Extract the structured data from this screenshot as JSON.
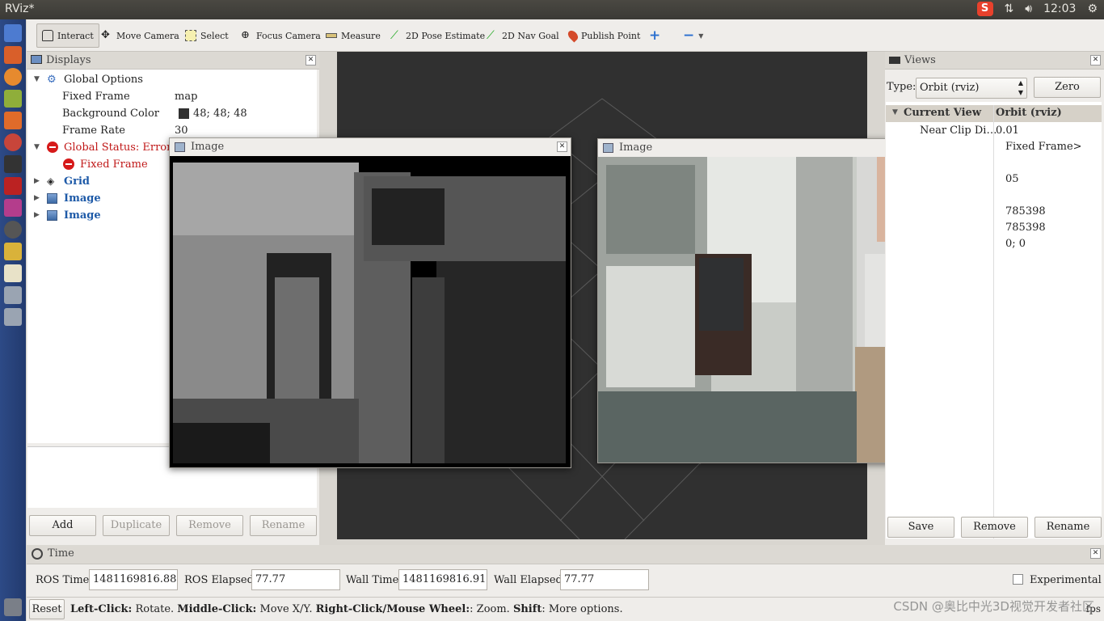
{
  "app": {
    "title": "RViz*"
  },
  "tray": {
    "clock": "12:03"
  },
  "toolbar": {
    "tools": [
      "Interact",
      "Move Camera",
      "Select",
      "Focus Camera",
      "Measure",
      "2D Pose Estimate",
      "2D Nav Goal",
      "Publish Point"
    ]
  },
  "displays": {
    "title": "Displays",
    "global_options": "Global Options",
    "fixed_frame_label": "Fixed Frame",
    "fixed_frame_value": "map",
    "bg_color_label": "Background Color",
    "bg_color_value": "48; 48; 48",
    "frame_rate_label": "Frame Rate",
    "frame_rate_value": "30",
    "global_status": "Global Status: Error",
    "fixed_frame_error": "Fixed Frame",
    "items": [
      "Grid",
      "Image",
      "Image"
    ],
    "buttons": {
      "add": "Add",
      "duplicate": "Duplicate",
      "remove": "Remove",
      "rename": "Rename"
    }
  },
  "image_windows": {
    "left_title": "Image",
    "right_title": "Image"
  },
  "views": {
    "title": "Views",
    "type_label": "Type:",
    "type_value": "Orbit (rviz)",
    "zero": "Zero",
    "current_view": "Current View",
    "current_view_value": "Orbit (rviz)",
    "near_clip": "Near Clip Di…",
    "near_clip_value": "0.01",
    "target_frame_value": "Fixed Frame>",
    "partial_values": [
      "05",
      "785398",
      "785398",
      "0; 0"
    ],
    "buttons": {
      "save": "Save",
      "remove": "Remove",
      "rename": "Rename"
    }
  },
  "time": {
    "title": "Time",
    "ros_time_label": "ROS Time:",
    "ros_time": "1481169816.88",
    "ros_elapsed_label": "ROS Elapsed:",
    "ros_elapsed": "77.77",
    "wall_time_label": "Wall Time:",
    "wall_time": "1481169816.91",
    "wall_elapsed_label": "Wall Elapsed:",
    "wall_elapsed": "77.77",
    "experimental": "Experimental"
  },
  "status": {
    "reset": "Reset",
    "k1": "Left-Click:",
    "v1": "Rotate.",
    "k2": "Middle-Click:",
    "v2": "Move X/Y.",
    "k3": "Right-Click/Mouse Wheel:",
    "v3": ": Zoom.",
    "k4": "Shift",
    "v4": ": More options.",
    "fps": "fps"
  },
  "watermark": "CSDN @奥比中光3D视觉开发者社区",
  "colors": {
    "viewport_bg": "#303030",
    "error_red": "#c01818",
    "link_blue": "#1e5aa8"
  }
}
